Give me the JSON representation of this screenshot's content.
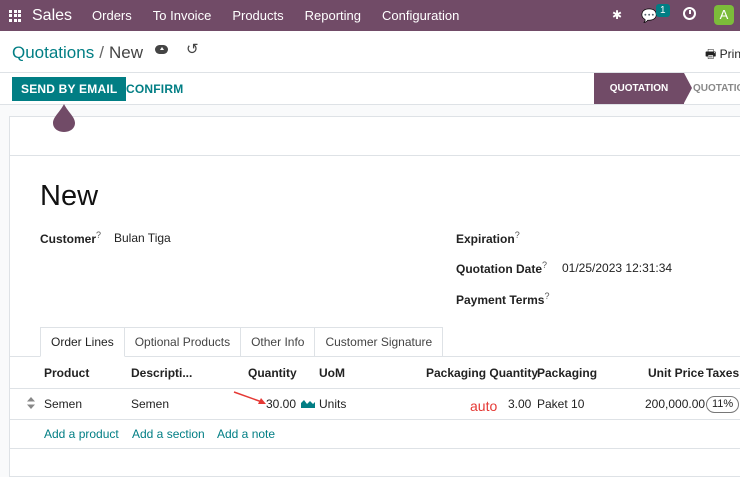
{
  "navbar": {
    "brand": "Sales",
    "menu": [
      "Orders",
      "To Invoice",
      "Products",
      "Reporting",
      "Configuration"
    ],
    "chat_badge": "1",
    "avatar_letter": "A"
  },
  "breadcrumb": {
    "parent": "Quotations",
    "separator": "/",
    "current": "New"
  },
  "print_label": "Prin",
  "statusbar": {
    "send_email": "SEND BY EMAIL",
    "confirm": "CONFIRM",
    "stage_active": "QUOTATION",
    "stage_next": "QUOTATIO"
  },
  "form": {
    "title": "New",
    "customer_label": "Customer",
    "customer_value": "Bulan Tiga",
    "expiration_label": "Expiration",
    "quotation_date_label": "Quotation Date",
    "quotation_date_value": "01/25/2023 12:31:34",
    "payment_terms_label": "Payment Terms",
    "help_mark": "?"
  },
  "tabs": [
    "Order Lines",
    "Optional Products",
    "Other Info",
    "Customer Signature"
  ],
  "table": {
    "headers": {
      "product": "Product",
      "description": "Descripti...",
      "quantity": "Quantity",
      "uom": "UoM",
      "packaging_quantity": "Packaging Quantity",
      "packaging": "Packaging",
      "unit_price": "Unit Price",
      "taxes": "Taxes"
    },
    "rows": [
      {
        "product": "Semen",
        "description": "Semen",
        "quantity": "30.00",
        "uom": "Units",
        "packaging_quantity": "3.00",
        "packaging": "Paket 10",
        "unit_price": "200,000.00",
        "taxes": "11%"
      }
    ],
    "add_product": "Add a product",
    "add_section": "Add a section",
    "add_note": "Add a note"
  },
  "annotation": {
    "auto_label": "auto",
    "color": "#e53935"
  },
  "colors": {
    "brand": "#714b67",
    "accent": "#017e84"
  }
}
